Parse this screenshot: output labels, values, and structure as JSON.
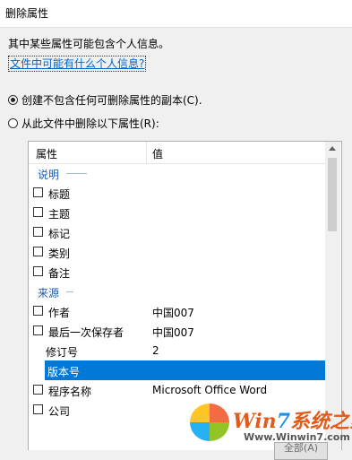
{
  "dialog": {
    "title": "删除属性",
    "intro": "其中某些属性可能包含个人信息。",
    "link": "文件中可能有什么个人信息?"
  },
  "options": {
    "option1": {
      "label": "创建不包含任何可删除属性的副本(C).",
      "selected": true
    },
    "option2": {
      "label": "从此文件中删除以下属性(R):",
      "selected": false
    }
  },
  "list": {
    "headers": {
      "property": "属性",
      "value": "值"
    },
    "groups": {
      "description": "说明",
      "origin": "来源"
    },
    "rows": [
      {
        "label": "标题",
        "value": "",
        "checkbox": true
      },
      {
        "label": "主题",
        "value": "",
        "checkbox": true
      },
      {
        "label": "标记",
        "value": "",
        "checkbox": true
      },
      {
        "label": "类别",
        "value": "",
        "checkbox": true
      },
      {
        "label": "备注",
        "value": "",
        "checkbox": true
      },
      {
        "label": "作者",
        "value": "中国007",
        "checkbox": true
      },
      {
        "label": "最后一次保存者",
        "value": "中国007",
        "checkbox": true
      },
      {
        "label": "修订号",
        "value": "2",
        "checkbox": false
      },
      {
        "label": "版本号",
        "value": "",
        "checkbox": false,
        "selected": true
      },
      {
        "label": "程序名称",
        "value": "Microsoft Office Word",
        "checkbox": true
      },
      {
        "label": "公司",
        "value": "",
        "checkbox": true
      }
    ]
  },
  "button": {
    "ok": "全部(A)"
  },
  "watermark": {
    "brand_win": "Win",
    "brand_7": "7",
    "brand_rest": "系统之家",
    "url": "Www.Winwin7.com"
  },
  "colors": {
    "accent": "#0078d7",
    "link": "#0066cc",
    "group_text": "#1e5aa8"
  }
}
